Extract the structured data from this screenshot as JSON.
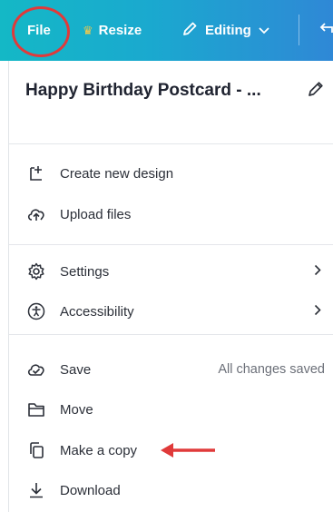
{
  "toolbar": {
    "file_label": "File",
    "resize_label": "Resize",
    "editing_label": "Editing"
  },
  "design": {
    "title": "Happy Birthday Postcard - ..."
  },
  "menu": {
    "create": "Create new design",
    "upload": "Upload files",
    "settings": "Settings",
    "accessibility": "Accessibility",
    "save": "Save",
    "save_status": "All changes saved",
    "move": "Move",
    "copy": "Make a copy",
    "download": "Download"
  },
  "colors": {
    "toolbar_start": "#14b8c6",
    "toolbar_end": "#2f88d6",
    "highlight_red": "#e03a3a"
  }
}
